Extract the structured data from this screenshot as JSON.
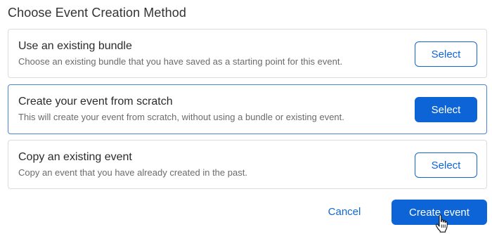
{
  "page": {
    "title": "Choose Event Creation Method"
  },
  "options": [
    {
      "title": "Use an existing bundle",
      "description": "Choose an existing bundle that you have saved as a starting point for this event.",
      "button_label": "Select"
    },
    {
      "title": "Create your event from scratch",
      "description": "This will create your event from scratch, without using a bundle or existing event.",
      "button_label": "Select",
      "selected": true
    },
    {
      "title": "Copy an existing event",
      "description": "Copy an event that you have already created in the past.",
      "button_label": "Select"
    }
  ],
  "footer": {
    "cancel_label": "Cancel",
    "create_label": "Create event"
  },
  "colors": {
    "primary": "#0d64d6",
    "selected_border": "#4b87d6",
    "card_border": "#dcdcdc"
  },
  "icons": {
    "cursor": "hand-pointer-icon"
  }
}
